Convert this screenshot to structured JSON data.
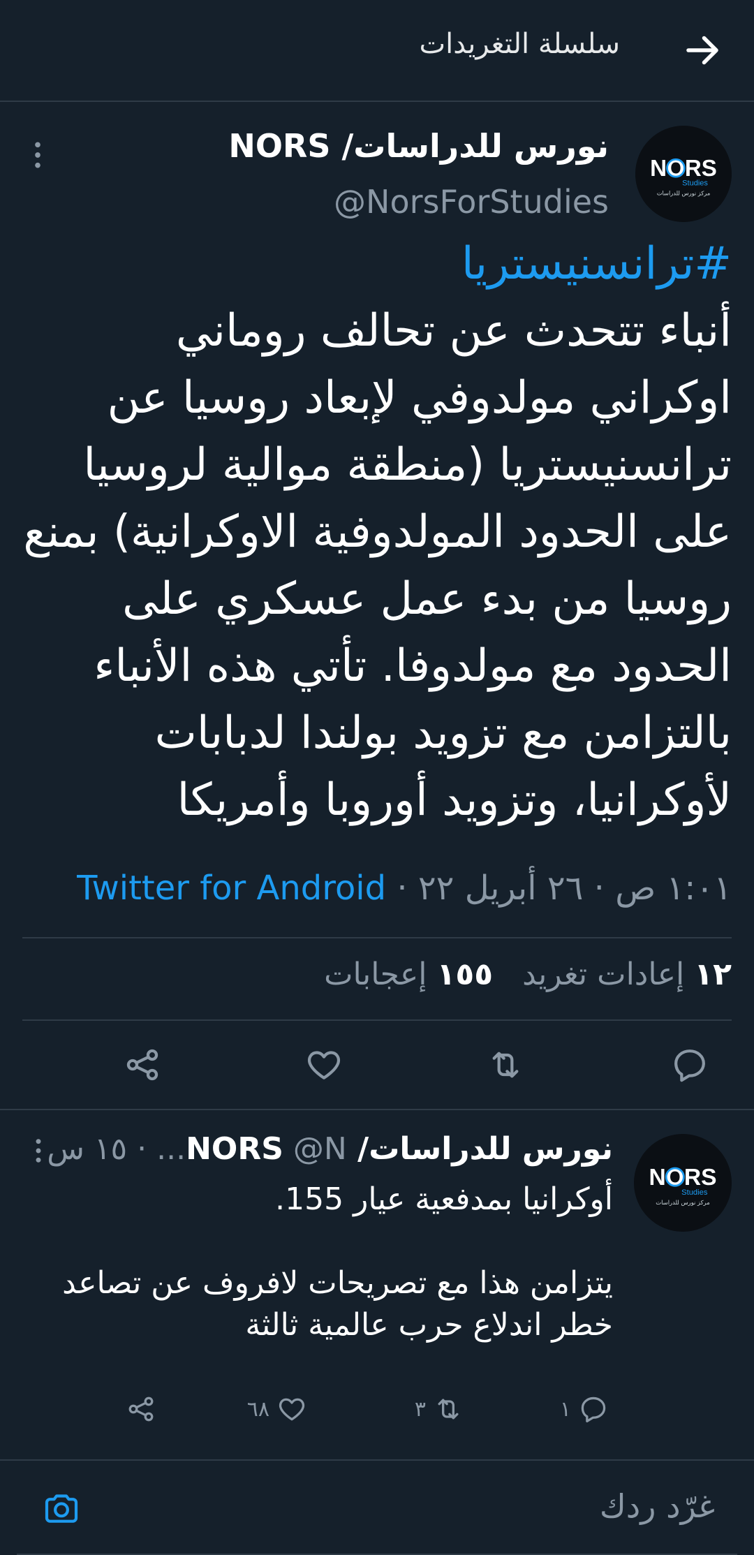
{
  "header": {
    "title": "سلسلة التغريدات"
  },
  "avatar": {
    "brand": "NORS",
    "sub": "Studies",
    "arabic": "مركز نورس للدراسات"
  },
  "main_tweet": {
    "author_name": "نورس للدراسات/ NORS",
    "author_handle": "@NorsForStudies",
    "hashtag": "#ترانسنيستريا",
    "text": "أنباء تتحدث عن تحالف روماني اوكراني مولدوفي لإبعاد روسيا عن ترانسنيستريا (منطقة موالية لروسيا على الحدود المولدوفية الاوكرانية) بمنع روسيا من بدء عمل عسكري على الحدود مع مولدوفا. تأتي هذه الأنباء بالتزامن مع تزويد بولندا لدبابات لأوكرانيا، وتزويد أوروبا وأمريكا",
    "time": "١:٠١ ص · ٢٦ أبريل ٢٢ · ",
    "source": "Twitter for Android",
    "retweets_count": "١٢",
    "retweets_label": "إعادات تغريد",
    "likes_count": "١٥٥",
    "likes_label": "إعجابات"
  },
  "reply_tweet": {
    "author_name": "نورس للدراسات/ NORS",
    "meta": " @N... · ١٥ س",
    "text": "أوكرانيا بمدفعية عيار 155.\n\nيتزامن هذا مع تصريحات لافروف عن تصاعد خطر اندلاع حرب عالمية ثالثة",
    "reply_count": "١",
    "retweet_count": "٣",
    "like_count": "٦٨"
  },
  "compose": {
    "placeholder": "غرّد ردك"
  },
  "colors": {
    "background": "#15202b",
    "accent": "#1d9bf0",
    "muted": "#8b98a5",
    "divider": "#2f3b47"
  }
}
